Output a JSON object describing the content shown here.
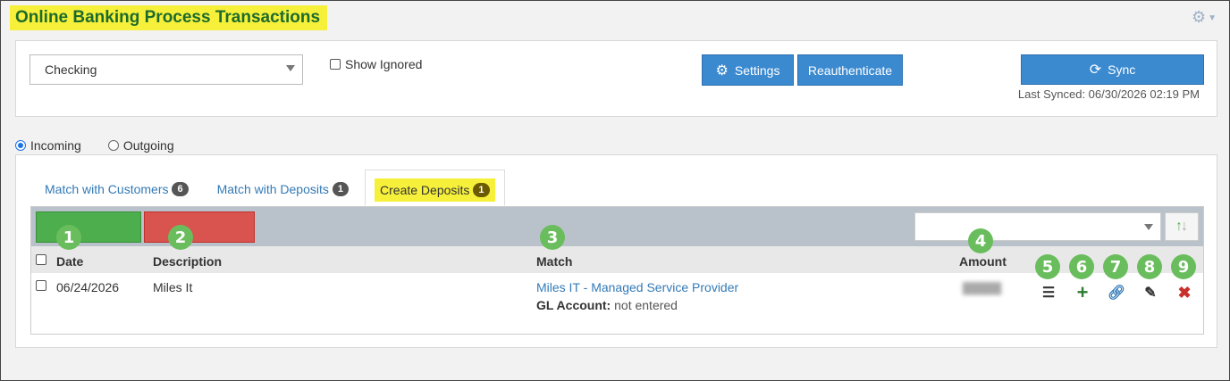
{
  "header": {
    "title": "Online Banking Process Transactions",
    "gear_icon": "gear-icon"
  },
  "top_panel": {
    "account_select": {
      "value": "Checking"
    },
    "show_ignored": {
      "label": "Show Ignored",
      "checked": false
    },
    "settings_button": "Settings",
    "reauth_button": "Reauthenticate",
    "sync_button": "Sync",
    "last_synced": "Last Synced: 06/30/2026 02:19 PM"
  },
  "direction": {
    "incoming": "Incoming",
    "outgoing": "Outgoing",
    "selected": "Incoming"
  },
  "tabs": [
    {
      "label": "Match with Customers",
      "count": "6"
    },
    {
      "label": "Match with Deposits",
      "count": "1"
    },
    {
      "label": "Create Deposits",
      "count": "1",
      "active": true
    }
  ],
  "table": {
    "columns": {
      "date": "Date",
      "description": "Description",
      "match": "Match",
      "amount": "Amount"
    },
    "rows": [
      {
        "date": "06/24/2026",
        "description": "Miles It",
        "match": "Miles IT - Managed Service Provider",
        "gl_label": "GL Account:",
        "gl_value": "not entered"
      }
    ]
  },
  "markers": [
    "1",
    "2",
    "3",
    "4",
    "5",
    "6",
    "7",
    "8",
    "9"
  ],
  "colors": {
    "highlight": "#f6f03a",
    "title": "#1d6b2c",
    "primary": "#3b8ad0",
    "marker": "#6abd5c"
  }
}
